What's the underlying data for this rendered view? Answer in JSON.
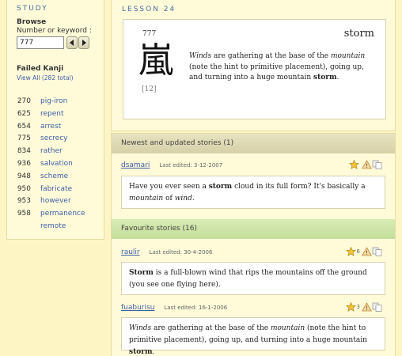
{
  "sidebar": {
    "heading": "STUDY",
    "browse_label": "Browse",
    "number_label": "Number or keyword :",
    "search_value": "777",
    "failed_heading": "Failed Kanji",
    "view_all": "View All (282 total)",
    "failed_items": [
      {
        "num": "270",
        "keyword": "pig-iron"
      },
      {
        "num": "625",
        "keyword": "repent"
      },
      {
        "num": "654",
        "keyword": "arrest"
      },
      {
        "num": "775",
        "keyword": "secrecy"
      },
      {
        "num": "834",
        "keyword": "rather"
      },
      {
        "num": "936",
        "keyword": "salvation"
      },
      {
        "num": "948",
        "keyword": "scheme"
      },
      {
        "num": "950",
        "keyword": "fabricate"
      },
      {
        "num": "953",
        "keyword": "however"
      },
      {
        "num": "958",
        "keyword": "permanence"
      }
    ],
    "extra_item": "remote"
  },
  "lesson": {
    "heading": "LESSON 24",
    "frame_number": "777",
    "kanji": "嵐",
    "stroke_count": "[12]",
    "keyword": "storm",
    "story": [
      {
        "t": "Winds",
        "s": "i"
      },
      {
        "t": " are gathering at the base of the ",
        "s": ""
      },
      {
        "t": "mountain",
        "s": "i"
      },
      {
        "t": " (note the hint to primitive placement), going up, and turning into a huge mountain ",
        "s": ""
      },
      {
        "t": "storm",
        "s": "b"
      },
      {
        "t": ".",
        "s": ""
      }
    ]
  },
  "newest": {
    "title": "Newest and updated stories (1)",
    "stories": [
      {
        "author": "dsamari",
        "edited": "Last edited: 3-12-2007",
        "stars": "",
        "text": [
          {
            "t": "Have you ever seen a ",
            "s": ""
          },
          {
            "t": "storm",
            "s": "b"
          },
          {
            "t": " cloud in its full form? It's basically a ",
            "s": ""
          },
          {
            "t": "mountain",
            "s": "i"
          },
          {
            "t": " of ",
            "s": ""
          },
          {
            "t": "wind",
            "s": "i"
          },
          {
            "t": ".",
            "s": ""
          }
        ]
      }
    ]
  },
  "favourite": {
    "title": "Favourite stories (16)",
    "stories": [
      {
        "author": "raulir",
        "edited": "Last edited: 30-4-2006",
        "stars": "6",
        "text": [
          {
            "t": "Storm",
            "s": "b"
          },
          {
            "t": " is a full-blown wind that rips the mountains off the ground (you see one flying here).",
            "s": ""
          }
        ]
      },
      {
        "author": "fuaburisu",
        "edited": "Last edited: 16-1-2006",
        "stars": "3",
        "text": [
          {
            "t": "Winds",
            "s": "i"
          },
          {
            "t": " are gathering at the base of the ",
            "s": ""
          },
          {
            "t": "mountain",
            "s": "i"
          },
          {
            "t": " (note the hint to primitive placement), going up, and turning into a huge mountain ",
            "s": ""
          },
          {
            "t": "storm",
            "s": "b"
          },
          {
            "t": ".",
            "s": ""
          }
        ]
      }
    ]
  },
  "colors": {
    "link": "#3d5fa8",
    "heading": "#4a6fa5",
    "page_bg": "#fdf5c4",
    "panel_bg": "#fffbd9",
    "fav_bar": "#cfe5a8",
    "new_bar": "#ddd8b4"
  },
  "icons": {
    "prev": "arrow-left-icon",
    "next": "arrow-right-icon",
    "star": "star-icon",
    "report": "warning-icon",
    "copy": "copy-icon"
  }
}
